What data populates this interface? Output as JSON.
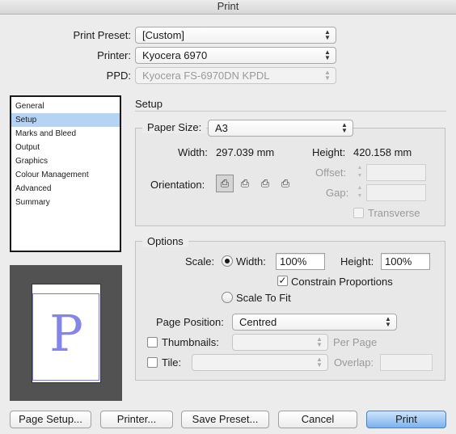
{
  "window": {
    "title": "Print"
  },
  "preset": {
    "label": "Print Preset:",
    "value": "[Custom]"
  },
  "printer": {
    "label": "Printer:",
    "value": "Kyocera 6970"
  },
  "ppd": {
    "label": "PPD:",
    "value": "Kyocera FS-6970DN KPDL"
  },
  "sidebar": {
    "items": [
      {
        "label": "General"
      },
      {
        "label": "Setup"
      },
      {
        "label": "Marks and Bleed"
      },
      {
        "label": "Output"
      },
      {
        "label": "Graphics"
      },
      {
        "label": "Colour Management"
      },
      {
        "label": "Advanced"
      },
      {
        "label": "Summary"
      }
    ],
    "selected": "Setup"
  },
  "section_title": "Setup",
  "paper": {
    "size_label": "Paper Size:",
    "size_value": "A3",
    "width_label": "Width:",
    "width_value": "297.039 mm",
    "height_label": "Height:",
    "height_value": "420.158 mm",
    "orientation_label": "Orientation:",
    "orientation_icons": [
      "portrait-icon",
      "landscape-icon",
      "reverse-portrait-icon",
      "reverse-landscape-icon"
    ],
    "offset_label": "Offset:",
    "gap_label": "Gap:",
    "transverse_label": "Transverse"
  },
  "options": {
    "title": "Options",
    "scale_label": "Scale:",
    "width_label": "Width:",
    "width_value": "100%",
    "height_label": "Height:",
    "height_value": "100%",
    "constrain_label": "Constrain Proportions",
    "scale_to_fit_label": "Scale To Fit",
    "page_position_label": "Page Position:",
    "page_position_value": "Centred",
    "thumbnails_label": "Thumbnails:",
    "per_page_label": "Per Page",
    "tile_label": "Tile:",
    "overlap_label": "Overlap:"
  },
  "preview": {
    "glyph": "P"
  },
  "buttons": {
    "page_setup": "Page Setup...",
    "printer": "Printer...",
    "save_preset": "Save Preset...",
    "cancel": "Cancel",
    "print": "Print"
  },
  "colors": {
    "accent": "#7cb2ec",
    "selection": "#b5d3f3",
    "preview_glyph": "#8585e8"
  }
}
